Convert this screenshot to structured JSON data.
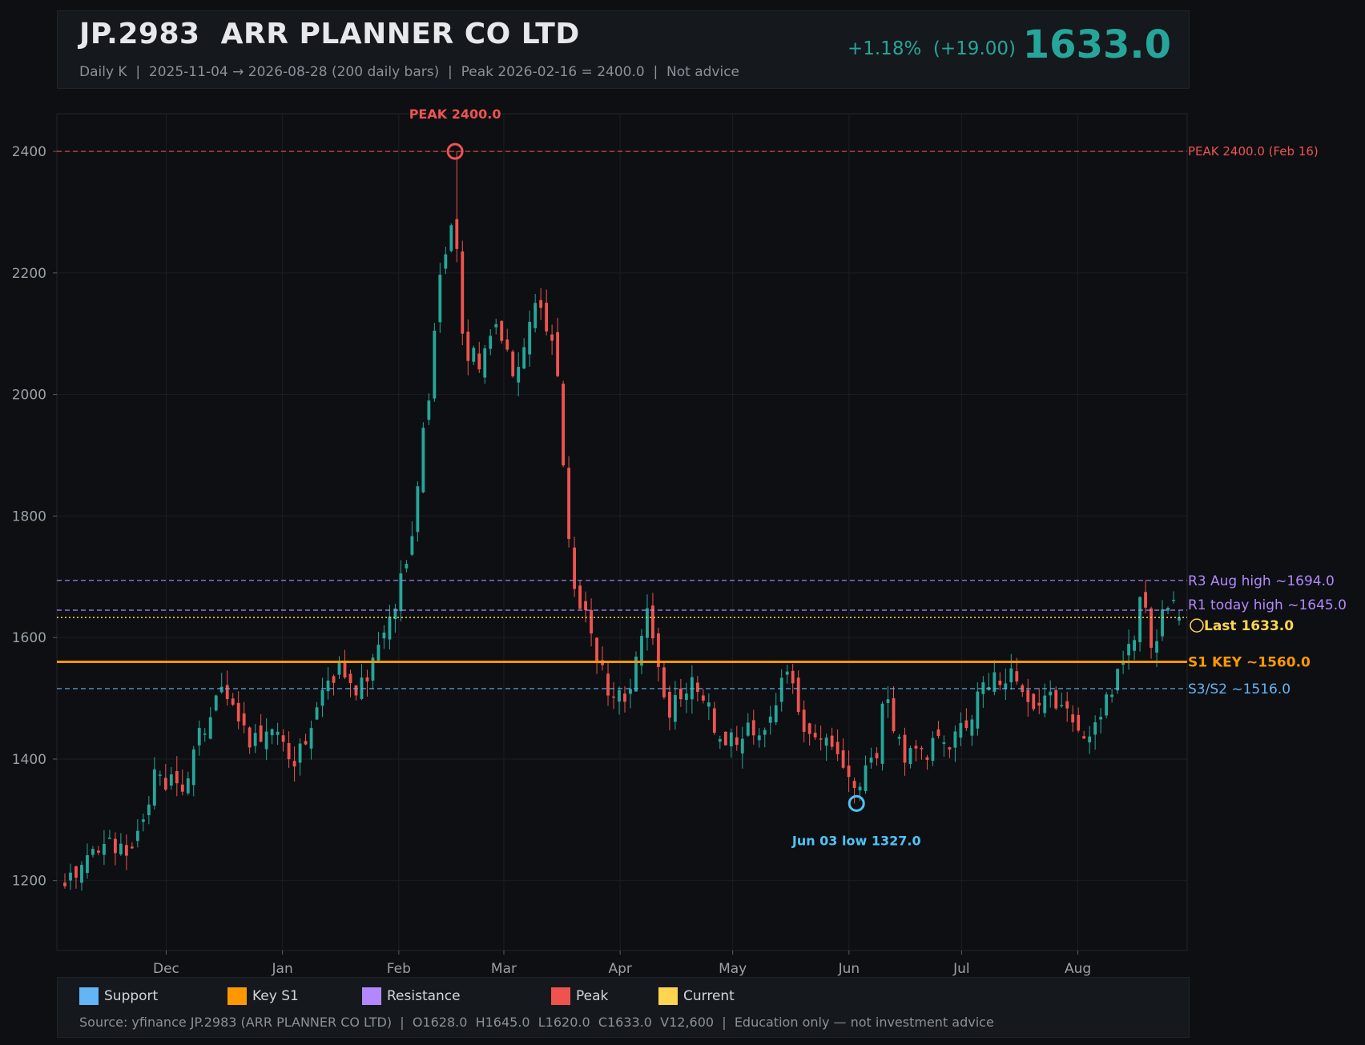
{
  "header": {
    "title": "JP.2983  ARR PLANNER CO LTD",
    "subtitle": "Daily K  |  2025-11-04 → 2026-08-28 (200 daily bars)  |  Peak 2026-02-16 = 2400.0  |  Not advice",
    "change": "+1.18%  (+19.00)",
    "price": "1633.0"
  },
  "colors": {
    "up": "#26a69a",
    "down": "#ef5350",
    "peak": "#ef5350",
    "support": "#64b5f6",
    "key": "#ff9800",
    "resistance": "#b388ff",
    "current": "#ffd54f",
    "low": "#4fc3f7"
  },
  "chart_data": {
    "type": "candlestick",
    "x_range": [
      "2025-11-04",
      "2026-08-28"
    ],
    "bars": 200,
    "ylim": [
      1085,
      2462
    ],
    "yticks": [
      1200,
      1400,
      1600,
      1800,
      2000,
      2200,
      2400
    ],
    "xticks": [
      {
        "label": "Dec",
        "date": "2025-12-01"
      },
      {
        "label": "Jan",
        "date": "2026-01-01"
      },
      {
        "label": "Feb",
        "date": "2026-02-01"
      },
      {
        "label": "Mar",
        "date": "2026-03-01"
      },
      {
        "label": "Apr",
        "date": "2026-04-01"
      },
      {
        "label": "May",
        "date": "2026-05-01"
      },
      {
        "label": "Jun",
        "date": "2026-06-01"
      },
      {
        "label": "Jul",
        "date": "2026-07-01"
      },
      {
        "label": "Aug",
        "date": "2026-08-01"
      }
    ],
    "grid": true,
    "close_anchors": [
      {
        "date": "2025-11-04",
        "close": 1205
      },
      {
        "date": "2025-11-14",
        "close": 1265
      },
      {
        "date": "2025-11-21",
        "close": 1240
      },
      {
        "date": "2025-11-28",
        "close": 1370
      },
      {
        "date": "2025-12-05",
        "close": 1355
      },
      {
        "date": "2025-12-10",
        "close": 1445
      },
      {
        "date": "2025-12-16",
        "close": 1520
      },
      {
        "date": "2025-12-24",
        "close": 1430
      },
      {
        "date": "2025-12-31",
        "close": 1435
      },
      {
        "date": "2026-01-05",
        "close": 1395
      },
      {
        "date": "2026-01-09",
        "close": 1465
      },
      {
        "date": "2026-01-16",
        "close": 1550
      },
      {
        "date": "2026-01-21",
        "close": 1505
      },
      {
        "date": "2026-01-27",
        "close": 1590
      },
      {
        "date": "2026-01-30",
        "close": 1620
      },
      {
        "date": "2026-02-04",
        "close": 1760
      },
      {
        "date": "2026-02-08",
        "close": 1950
      },
      {
        "date": "2026-02-13",
        "close": 2240
      },
      {
        "date": "2026-02-16",
        "close": 2280
      },
      {
        "date": "2026-02-18",
        "close": 2080
      },
      {
        "date": "2026-02-22",
        "close": 2050
      },
      {
        "date": "2026-02-27",
        "close": 2120
      },
      {
        "date": "2026-03-04",
        "close": 2020
      },
      {
        "date": "2026-03-10",
        "close": 2150
      },
      {
        "date": "2026-03-15",
        "close": 2060
      },
      {
        "date": "2026-03-18",
        "close": 1760
      },
      {
        "date": "2026-03-21",
        "close": 1660
      },
      {
        "date": "2026-03-25",
        "close": 1590
      },
      {
        "date": "2026-03-30",
        "close": 1500
      },
      {
        "date": "2026-04-04",
        "close": 1520
      },
      {
        "date": "2026-04-08",
        "close": 1660
      },
      {
        "date": "2026-04-14",
        "close": 1480
      },
      {
        "date": "2026-04-20",
        "close": 1540
      },
      {
        "date": "2026-04-27",
        "close": 1440
      },
      {
        "date": "2026-05-08",
        "close": 1440
      },
      {
        "date": "2026-05-15",
        "close": 1540
      },
      {
        "date": "2026-05-22",
        "close": 1430
      },
      {
        "date": "2026-05-29",
        "close": 1420
      },
      {
        "date": "2026-06-03",
        "close": 1350
      },
      {
        "date": "2026-06-08",
        "close": 1400
      },
      {
        "date": "2026-06-11",
        "close": 1520
      },
      {
        "date": "2026-06-15",
        "close": 1400
      },
      {
        "date": "2026-06-23",
        "close": 1415
      },
      {
        "date": "2026-06-30",
        "close": 1430
      },
      {
        "date": "2026-07-07",
        "close": 1520
      },
      {
        "date": "2026-07-14",
        "close": 1540
      },
      {
        "date": "2026-07-21",
        "close": 1490
      },
      {
        "date": "2026-07-28",
        "close": 1500
      },
      {
        "date": "2026-08-03",
        "close": 1440
      },
      {
        "date": "2026-08-10",
        "close": 1510
      },
      {
        "date": "2026-08-15",
        "close": 1580
      },
      {
        "date": "2026-08-18",
        "close": 1680
      },
      {
        "date": "2026-08-21",
        "close": 1580
      },
      {
        "date": "2026-08-24",
        "close": 1675
      },
      {
        "date": "2026-08-28",
        "close": 1633
      }
    ],
    "peak": {
      "date": "2026-02-16",
      "value": 2400.0,
      "label": "PEAK 2400.0",
      "line_label": "PEAK 2400.0 (Feb 16)"
    },
    "low": {
      "date": "2026-06-03",
      "value": 1327.0,
      "label": "Jun 03 low 1327.0"
    },
    "levels": [
      {
        "name": "R3 Aug high ~1694.0",
        "value": 1694.0,
        "kind": "resistance"
      },
      {
        "name": "R1 today high ~1645.0",
        "value": 1645.0,
        "kind": "resistance"
      },
      {
        "name": "Last 1633.0",
        "value": 1633.0,
        "kind": "current"
      },
      {
        "name": "S1 KEY ~1560.0",
        "value": 1560.0,
        "kind": "key"
      },
      {
        "name": "S3/S2 ~1516.0",
        "value": 1516.0,
        "kind": "support"
      }
    ],
    "last": {
      "open": 1628.0,
      "high": 1645.0,
      "low": 1620.0,
      "close": 1633.0,
      "volume": "12,600"
    }
  },
  "legend": [
    {
      "label": "Support",
      "color": "#64b5f6"
    },
    {
      "label": "Key S1",
      "color": "#ff9800"
    },
    {
      "label": "Resistance",
      "color": "#b388ff"
    },
    {
      "label": "Peak",
      "color": "#ef5350"
    },
    {
      "label": "Current",
      "color": "#ffd54f"
    }
  ],
  "footer": {
    "source": "Source: yfinance JP.2983 (ARR PLANNER CO LTD)  |  O1628.0  H1645.0  L1620.0  C1633.0  V12,600  |  Education only — not investment advice"
  }
}
